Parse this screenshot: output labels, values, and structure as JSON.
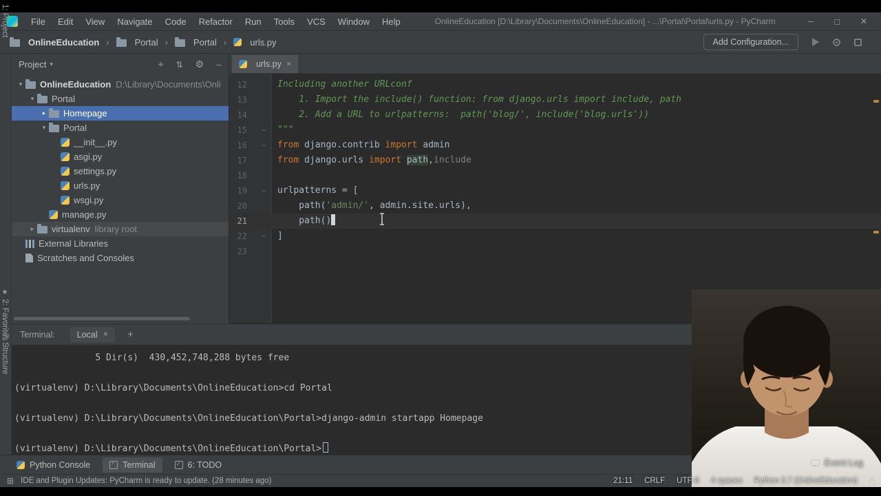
{
  "window": {
    "title": "OnlineEducation [D:\\Library\\Documents\\OnlineEducation] - ...\\Portal\\Portal\\urls.py - PyCharm",
    "menu_items": [
      "File",
      "Edit",
      "View",
      "Navigate",
      "Code",
      "Refactor",
      "Run",
      "Tools",
      "VCS",
      "Window",
      "Help"
    ]
  },
  "nav": {
    "breadcrumbs": [
      "OnlineEducation",
      "Portal",
      "Portal",
      "urls.py"
    ],
    "add_configuration_label": "Add Configuration..."
  },
  "tool_stripes": {
    "project": "1: Project",
    "favorites": "2: Favorites",
    "structure": "7: Structure"
  },
  "project_panel": {
    "title": "Project",
    "tree": [
      {
        "level": 0,
        "arrow": "down",
        "icon": "folder",
        "label": "OnlineEducation",
        "sublabel": "D:\\Library\\Documents\\Onli",
        "bold": true
      },
      {
        "level": 1,
        "arrow": "down",
        "icon": "folder",
        "label": "Portal"
      },
      {
        "level": 2,
        "arrow": "right",
        "icon": "folder",
        "label": "Homepage",
        "selected": true
      },
      {
        "level": 2,
        "arrow": "down",
        "icon": "folder",
        "label": "Portal"
      },
      {
        "level": 3,
        "icon": "python",
        "label": "__init__.py"
      },
      {
        "level": 3,
        "icon": "python",
        "label": "asgi.py"
      },
      {
        "level": 3,
        "icon": "python",
        "label": "settings.py"
      },
      {
        "level": 3,
        "icon": "python",
        "label": "urls.py"
      },
      {
        "level": 3,
        "icon": "python",
        "label": "wsgi.py"
      },
      {
        "level": 2,
        "icon": "python",
        "label": "manage.py"
      },
      {
        "level": 1,
        "arrow": "right",
        "icon": "folder",
        "label": "virtualenv",
        "sublabel": "library root",
        "hover": true
      },
      {
        "level": 0,
        "icon": "libraries",
        "label": "External Libraries"
      },
      {
        "level": 0,
        "icon": "scratches",
        "label": "Scratches and Consoles"
      }
    ]
  },
  "editor": {
    "tab_label": "urls.py",
    "lines": [
      {
        "num": 12,
        "segs": [
          [
            "doc",
            "Including another URLconf"
          ]
        ]
      },
      {
        "num": 13,
        "segs": [
          [
            "doc",
            "    1. Import the include() function: from django.urls import include, path"
          ]
        ]
      },
      {
        "num": 14,
        "segs": [
          [
            "doc",
            "    2. Add a URL to urlpatterns:  path('blog/', include('blog.urls'))"
          ]
        ]
      },
      {
        "num": 15,
        "fold": true,
        "segs": [
          [
            "doc",
            "\"\"\""
          ]
        ]
      },
      {
        "num": 16,
        "fold": true,
        "segs": [
          [
            "kw",
            "from"
          ],
          [
            "txt",
            " django.contrib "
          ],
          [
            "kw",
            "import"
          ],
          [
            "txt",
            " admin"
          ]
        ]
      },
      {
        "num": 17,
        "segs": [
          [
            "kw",
            "from"
          ],
          [
            "txt",
            " django.urls "
          ],
          [
            "kw",
            "import"
          ],
          [
            "txt",
            " "
          ],
          [
            "hl",
            "path"
          ],
          [
            "txt",
            ","
          ],
          [
            "dim",
            "include"
          ]
        ]
      },
      {
        "num": 18,
        "segs": []
      },
      {
        "num": 19,
        "fold": true,
        "segs": [
          [
            "txt",
            "urlpatterns = ["
          ]
        ]
      },
      {
        "num": 20,
        "segs": [
          [
            "txt",
            "    path("
          ],
          [
            "str",
            "'admin/'"
          ],
          [
            "txt",
            ", admin.site.urls),"
          ]
        ]
      },
      {
        "num": 21,
        "caret": true,
        "segs": [
          [
            "txt",
            "    path()"
          ]
        ]
      },
      {
        "num": 22,
        "fold": true,
        "segs": [
          [
            "txt",
            "]"
          ]
        ]
      },
      {
        "num": 23,
        "segs": []
      }
    ]
  },
  "terminal": {
    "label": "Terminal:",
    "tab_label": "Local",
    "lines": [
      "               5 Dir(s)  430,452,748,288 bytes free",
      "",
      "(virtualenv) D:\\Library\\Documents\\OnlineEducation>cd Portal",
      "",
      "(virtualenv) D:\\Library\\Documents\\OnlineEducation\\Portal>django-admin startapp Homepage",
      "",
      "(virtualenv) D:\\Library\\Documents\\OnlineEducation\\Portal>"
    ]
  },
  "bottom_bar": {
    "items": [
      {
        "label": "Python Console",
        "icon": "python"
      },
      {
        "label": "Terminal",
        "icon": "terminal",
        "active": true
      },
      {
        "label": "6: TODO",
        "icon": "todo"
      }
    ],
    "event_log_label": "Event Log"
  },
  "status_bar": {
    "message": "IDE and Plugin Updates: PyCharm is ready to update. (28 minutes ago)",
    "caret_position": "21:11",
    "line_separator": "CRLF",
    "encoding": "UTF-8",
    "indent": "4 spaces",
    "interpreter": "Python 3.7 (OnlineEducation)"
  }
}
